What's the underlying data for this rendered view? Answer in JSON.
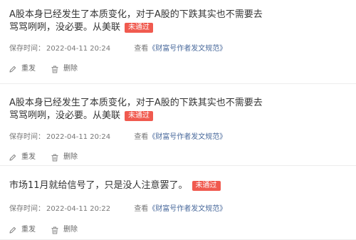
{
  "posts": [
    {
      "title": "A股本身已经发生了本质变化，对于A股的下跌其实也不需要去骂骂咧咧，没必要。从美联",
      "badge": "未通过",
      "time_label": "保存时间：",
      "time": "2022-04-11 20:24",
      "view_prefix": "查看",
      "view_link": "《财富号作者发文规范》",
      "resend": "重发",
      "delete": "删除"
    },
    {
      "title": "A股本身已经发生了本质变化，对于A股的下跌其实也不需要去骂骂咧咧，没必要。从美联",
      "badge": "未通过",
      "time_label": "保存时间：",
      "time": "2022-04-11 20:24",
      "view_prefix": "查看",
      "view_link": "《财富号作者发文规范》",
      "resend": "重发",
      "delete": "删除"
    },
    {
      "title": "市场11月就给信号了，只是没人注意罢了。",
      "badge": "未通过",
      "time_label": "保存时间：",
      "time": "2022-04-11 20:22",
      "view_prefix": "查看",
      "view_link": "《财富号作者发文规范》",
      "resend": "重发",
      "delete": "删除"
    }
  ],
  "icons": {
    "resend": "pencil-icon",
    "delete": "trash-icon"
  },
  "colors": {
    "badge_bg": "#f05a4f",
    "link": "#4a6a9c",
    "divider": "#ededed"
  }
}
